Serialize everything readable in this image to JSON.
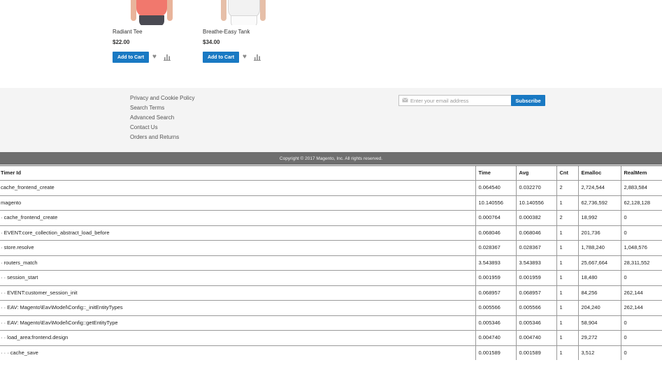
{
  "products": [
    {
      "name": "Radiant Tee",
      "price": "$22.00",
      "add_to_cart": "Add to Cart"
    },
    {
      "name": "Breathe-Easy Tank",
      "price": "$34.00",
      "add_to_cart": "Add to Cart"
    }
  ],
  "footer": {
    "links": [
      "Privacy and Cookie Policy",
      "Search Terms",
      "Advanced Search",
      "Contact Us",
      "Orders and Returns"
    ],
    "newsletter_placeholder": "Enter your email address",
    "subscribe_label": "Subscribe",
    "copyright": "Copyright © 2017 Magento, Inc. All rights reserved."
  },
  "profiler": {
    "headers": [
      "Timer Id",
      "Time",
      "Avg",
      "Cnt",
      "Emalloc",
      "RealMem"
    ],
    "rows": [
      [
        "cache_frontend_create",
        "0.064540",
        "0.032270",
        "2",
        "2,724,544",
        "2,883,584"
      ],
      [
        "magento",
        "10.140556",
        "10.140556",
        "1",
        "62,736,592",
        "62,128,128"
      ],
      [
        "· cache_frontend_create",
        "0.000764",
        "0.000382",
        "2",
        "18,992",
        "0"
      ],
      [
        "· EVENT:core_collection_abstract_load_before",
        "0.068046",
        "0.068046",
        "1",
        "201,736",
        "0"
      ],
      [
        "· store.resolve",
        "0.028367",
        "0.028367",
        "1",
        "1,788,240",
        "1,048,576"
      ],
      [
        "· routers_match",
        "3.543893",
        "3.543893",
        "1",
        "25,667,664",
        "28,311,552"
      ],
      [
        "· · session_start",
        "0.001959",
        "0.001959",
        "1",
        "18,480",
        "0"
      ],
      [
        "· · EVENT:customer_session_init",
        "0.068957",
        "0.068957",
        "1",
        "84,256",
        "262,144"
      ],
      [
        "· · EAV: Magento\\Eav\\Model\\Config::_initEntityTypes",
        "0.005566",
        "0.005566",
        "1",
        "204,240",
        "262,144"
      ],
      [
        "· · EAV: Magento\\Eav\\Model\\Config::getEntityType",
        "0.005346",
        "0.005346",
        "1",
        "58,904",
        "0"
      ],
      [
        "· · load_area:frontend.design",
        "0.004740",
        "0.004740",
        "1",
        "29,272",
        "0"
      ],
      [
        "· · · cache_save",
        "0.001589",
        "0.001589",
        "1",
        "3,512",
        "0"
      ]
    ]
  },
  "icons": {
    "wishlist": "heart-icon",
    "compare": "bar-chart-icon",
    "email": "envelope-icon"
  }
}
